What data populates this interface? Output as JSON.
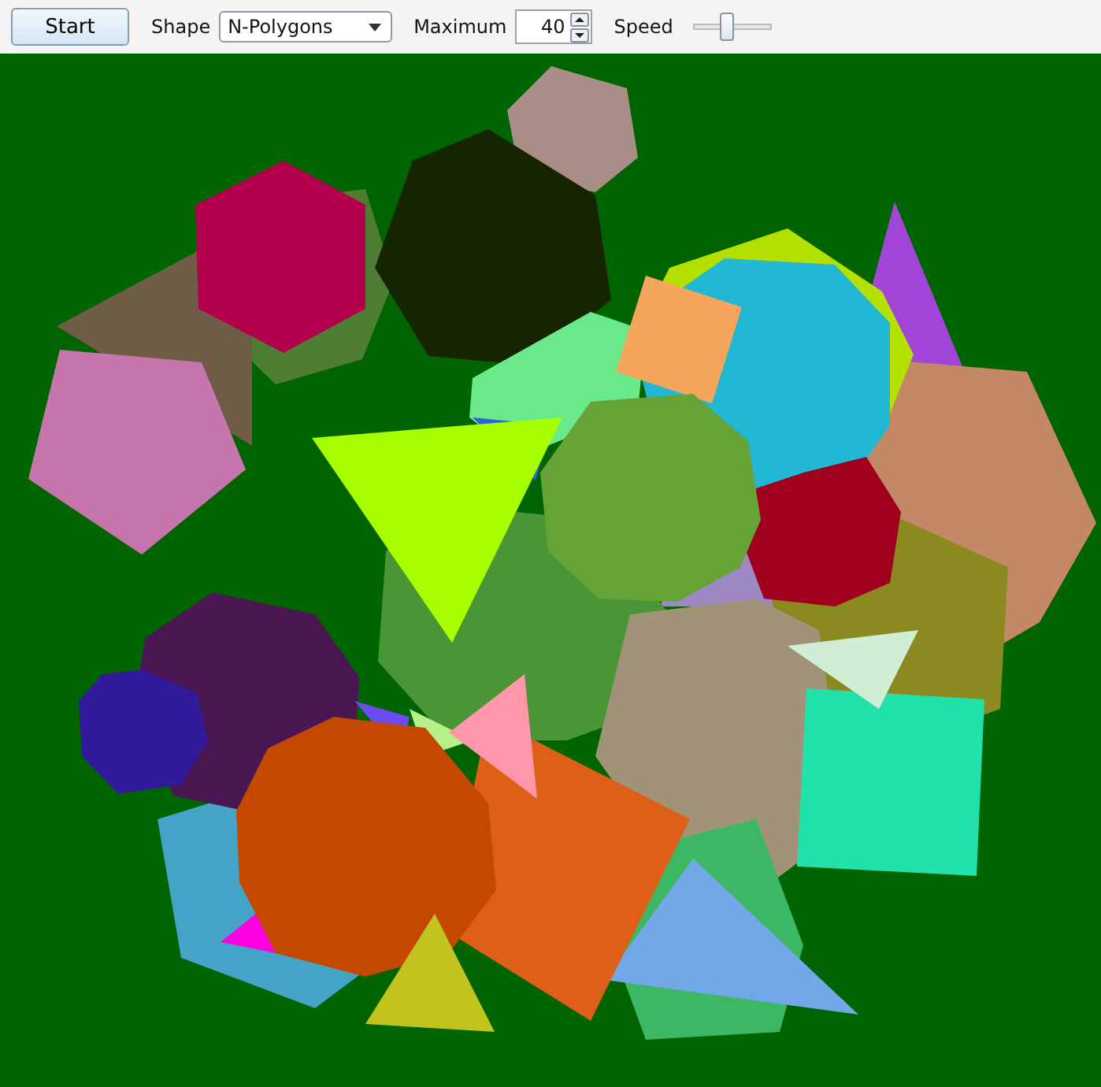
{
  "toolbar": {
    "start_button": "Start",
    "shape": {
      "label": "Shape",
      "value": "N-Polygons"
    },
    "maximum": {
      "label": "Maximum",
      "value": "40"
    },
    "speed": {
      "label": "Speed",
      "level": 0.42
    }
  }
}
